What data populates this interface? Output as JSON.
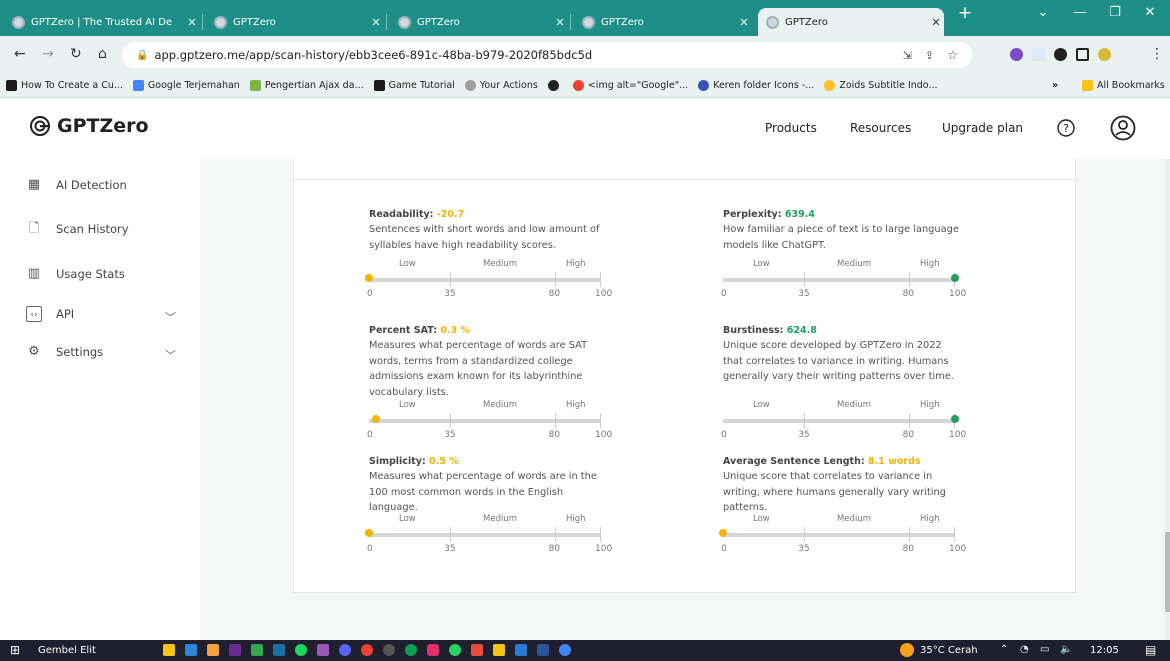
{
  "browser": {
    "tabs": [
      {
        "title": "GPTZero | The Trusted AI De",
        "active": false
      },
      {
        "title": "GPTZero",
        "active": false
      },
      {
        "title": "GPTZero",
        "active": false
      },
      {
        "title": "GPTZero",
        "active": false
      },
      {
        "title": "GPTZero",
        "active": true
      }
    ],
    "url": "app.gptzero.me/app/scan-history/ebb3cee6-891c-48ba-b979-2020f85bdc5d",
    "bookmarks": [
      {
        "label": "How To Create a Cu...",
        "color": "#1b1b1b"
      },
      {
        "label": "Google Terjemahan",
        "color": "#4285f4"
      },
      {
        "label": "Pengertian Ajax da...",
        "color": "#7cb342"
      },
      {
        "label": "Game Tutorial",
        "color": "#1b1b1b"
      },
      {
        "label": "Your Actions",
        "color": "#9e9e9e"
      },
      {
        "label": "",
        "color": "#222222"
      },
      {
        "label": "<img alt=\"Google\"...",
        "color": "#ea4335"
      },
      {
        "label": "Keren folder Icons -...",
        "color": "#3f51b5"
      },
      {
        "label": "Zoids Subtitle Indo...",
        "color": "#fbc02d"
      }
    ],
    "all_bookmarks": "All Bookmarks"
  },
  "app": {
    "brand": "GPTZero",
    "nav": {
      "products": "Products",
      "resources": "Resources",
      "upgrade": "Upgrade plan"
    },
    "sidebar": [
      {
        "label": "AI Detection",
        "icon": "grid-icon"
      },
      {
        "label": "Scan History",
        "icon": "file-history-icon"
      },
      {
        "label": "Usage Stats",
        "icon": "bar-chart-icon"
      },
      {
        "label": "API",
        "icon": "code-icon"
      },
      {
        "label": "Settings",
        "icon": "gear-icon"
      }
    ]
  },
  "scale_labels": {
    "low": "Low",
    "medium": "Medium",
    "high": "High"
  },
  "scale_ticks": [
    "0",
    "35",
    "80",
    "100"
  ],
  "metrics": [
    {
      "title": "Readability:",
      "value": "-20.7",
      "value_color": "#f4b400",
      "dot_color": "#f4b400",
      "level": 0,
      "desc": "Sentences with short words and low amount of syllables have high readability scores."
    },
    {
      "title": "Perplexity:",
      "value": "639.4",
      "value_color": "#1e9e63",
      "dot_color": "#1e9e63",
      "level": 100,
      "desc": "How familiar a piece of text is to large language models like ChatGPT."
    },
    {
      "title": "Percent SAT:",
      "value": "0.3 %",
      "value_color": "#f4b400",
      "dot_color": "#f4b400",
      "level": 3,
      "desc": "Measures what percentage of words are SAT words, terms from a standardized college admissions exam known for its labyrinthine vocabulary lists."
    },
    {
      "title": "Burstiness:",
      "value": "624.8",
      "value_color": "#1e9e63",
      "dot_color": "#1e9e63",
      "level": 100,
      "desc": "Unique score developed by GPTZero in 2022 that correlates to variance in writing. Humans generally vary their writing patterns over time."
    },
    {
      "title": "Simplicity:",
      "value": "0.5 %",
      "value_color": "#f4b400",
      "dot_color": "#f4b400",
      "level": 0,
      "desc": "Measures what percentage of words are in the 100 most common words in the English language."
    },
    {
      "title": "Average Sentence Length:",
      "value": "8.1 words",
      "value_color": "#f4b400",
      "dot_color": "#f4b400",
      "level": 0,
      "desc": "Unique score that correlates to variance in writing, where humans generally vary writing patterns."
    }
  ],
  "taskbar": {
    "user": "Gembel Elit",
    "weather": "35°C Cerah",
    "clock": "12:05"
  }
}
